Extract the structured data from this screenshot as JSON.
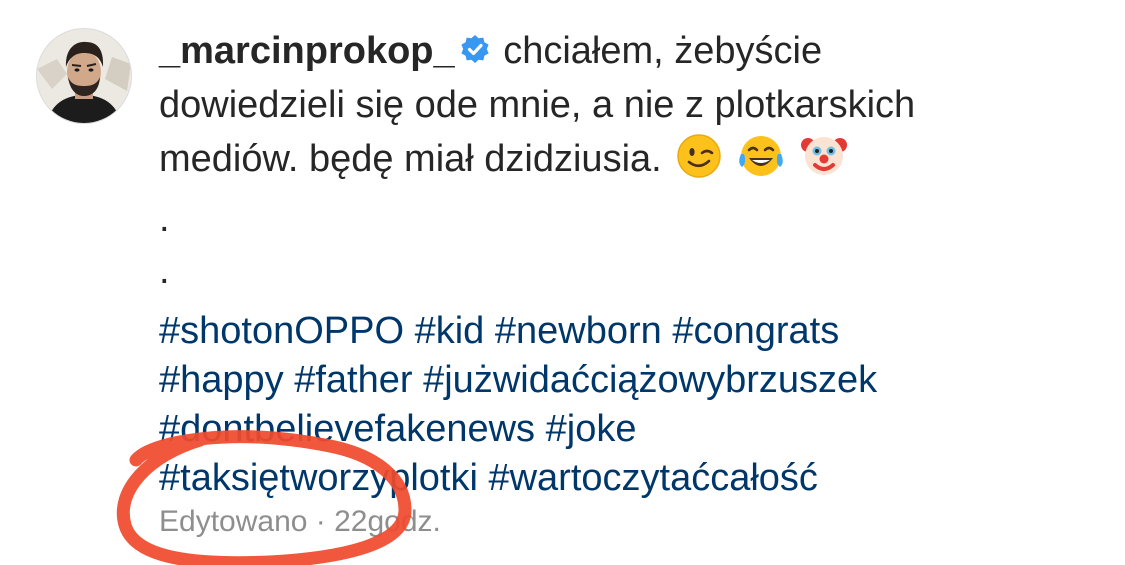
{
  "post": {
    "username": "_marcinprokop_",
    "verified_badge_icon": "verified-badge-icon",
    "caption_line1": "chciałem, żebyście",
    "caption_line2": "dowiedzieli się ode mnie, a nie z plotkarskich",
    "caption_line3": "mediów. będę miał dzidziusia.",
    "emojis": [
      "winking-face-emoji",
      "tears-of-joy-emoji",
      "clown-face-emoji"
    ],
    "dot1": ".",
    "dot2": ".",
    "hashtags": [
      "#shotonOPPO",
      "#kid",
      "#newborn",
      "#congrats",
      "#happy",
      "#father",
      "#jużwidaćciążowybrzuszek",
      "#dontbelievefakenews",
      "#joke",
      "#taksiętworzyplotki",
      "#wartoczytaćcałość"
    ],
    "edited_label": "Edytowano",
    "separator": "·",
    "time": "22godz."
  },
  "colors": {
    "text": "#262626",
    "hashtag": "#00376b",
    "meta": "#8e8e8e",
    "verified": "#3897f0",
    "scribble": "#ef4a2d"
  }
}
